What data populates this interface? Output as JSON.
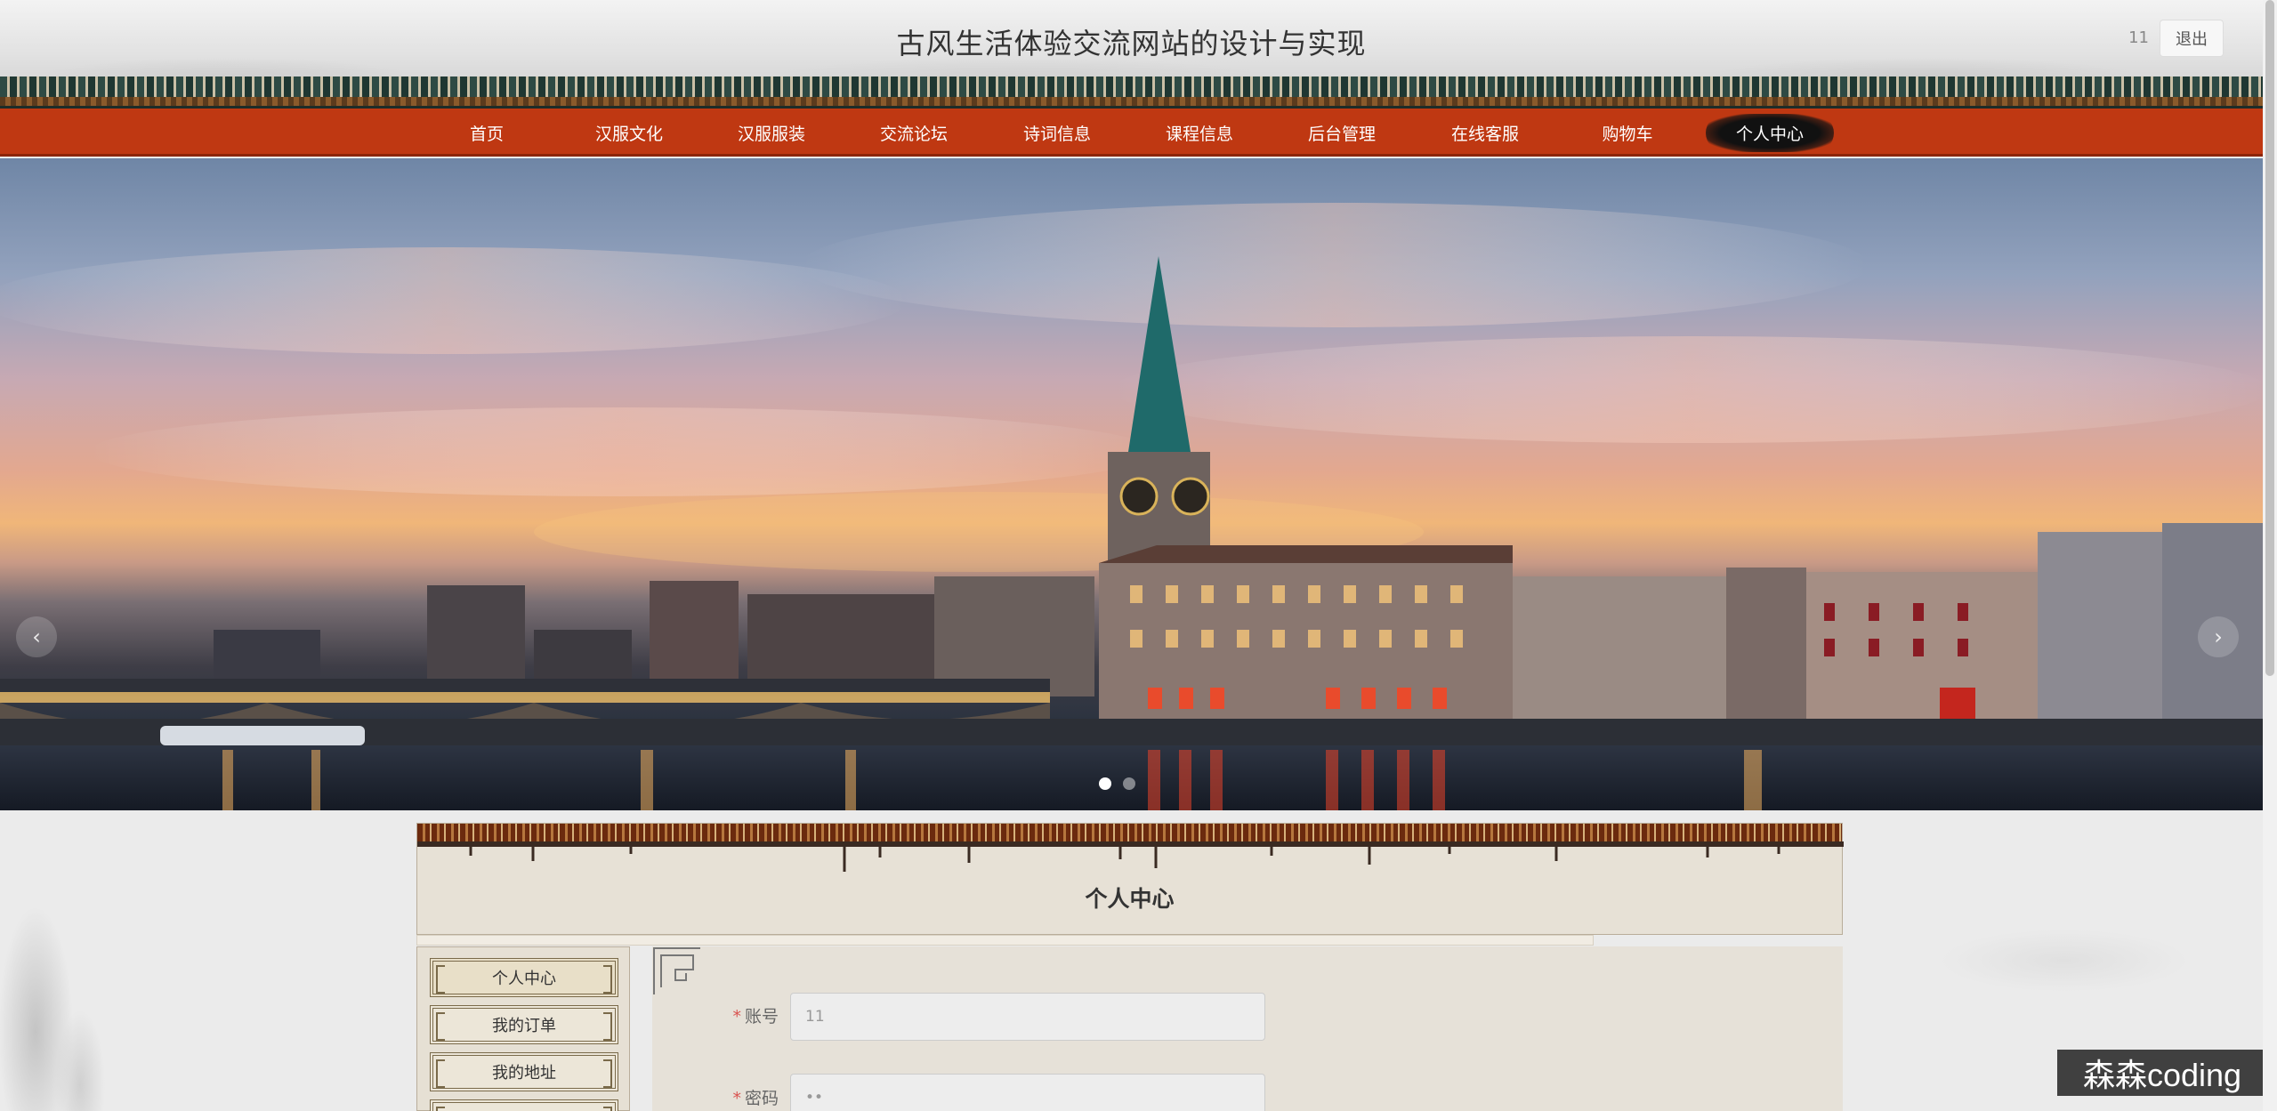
{
  "header": {
    "site_title": "古风生活体验交流网站的设计与实现",
    "username": "11",
    "logout_label": "退出"
  },
  "nav": {
    "items": [
      {
        "label": "首页"
      },
      {
        "label": "汉服文化"
      },
      {
        "label": "汉服服装"
      },
      {
        "label": "交流论坛"
      },
      {
        "label": "诗词信息"
      },
      {
        "label": "课程信息"
      },
      {
        "label": "后台管理"
      },
      {
        "label": "在线客服"
      },
      {
        "label": "购物车"
      },
      {
        "label": "个人中心"
      }
    ],
    "active_label": "个人中心"
  },
  "banner": {
    "prev_icon": "chevron-left-icon",
    "next_icon": "chevron-right-icon",
    "slide_count": 2,
    "active_slide": 1
  },
  "panel": {
    "title": "个人中心"
  },
  "sidebar": {
    "items": [
      {
        "label": "个人中心"
      },
      {
        "label": "我的订单"
      },
      {
        "label": "我的地址"
      }
    ]
  },
  "form": {
    "account": {
      "label": "账号",
      "value": "11"
    },
    "password": {
      "label": "密码",
      "value": "••"
    }
  },
  "watermark": "森森coding",
  "colors": {
    "nav_bg": "#bf3812",
    "panel_bg": "#e7e1d6",
    "required_mark": "#d9534f"
  }
}
